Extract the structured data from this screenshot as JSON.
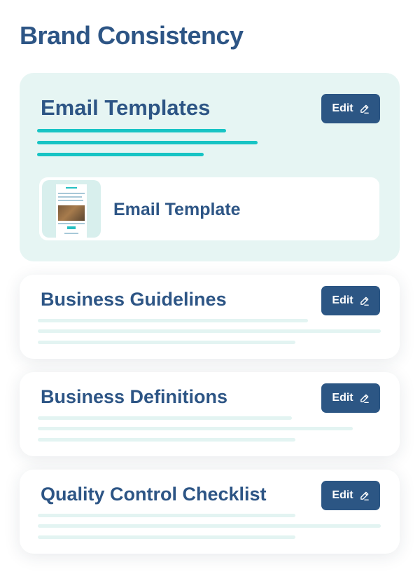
{
  "page": {
    "title": "Brand Consistency"
  },
  "cards": [
    {
      "title": "Email Templates",
      "edit_label": "Edit",
      "active": true,
      "items": [
        {
          "label": "Email Template"
        }
      ]
    },
    {
      "title": "Business Guidelines",
      "edit_label": "Edit",
      "active": false
    },
    {
      "title": "Business Definitions",
      "edit_label": "Edit",
      "active": false
    },
    {
      "title": "Quality Control Checklist",
      "edit_label": "Edit",
      "active": false
    }
  ],
  "colors": {
    "title_text": "#2d5585",
    "button_bg": "#2c5684",
    "active_card_bg": "#e6f5f3",
    "accent_line": "#17c4c4",
    "placeholder_line": "#e3f4f2"
  },
  "icons": {
    "edit": "pencil-icon"
  }
}
